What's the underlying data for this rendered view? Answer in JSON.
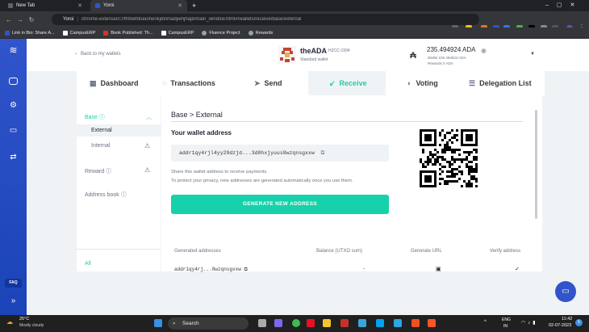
{
  "browser": {
    "tabs": [
      {
        "title": "New Tab"
      },
      {
        "title": "Yoroi"
      }
    ],
    "url_name": "Yoroi",
    "url": "chrome-extension://ffnbelfdoeiohenkjibnmadjiehjhajb/main_window.html#/wallets/receive/base/external",
    "bookmarks": [
      "Link in Bio: Share A...",
      "CampusERP",
      "Book Published: Th...",
      "CampusERP",
      "Fluence Project",
      "Rewards"
    ]
  },
  "header": {
    "back": "Back to my wallets",
    "wallet_name": "theADA",
    "wallet_code": "HZCC-1594",
    "wallet_type": "Standard wallet",
    "balance": "235.494924 ADA",
    "wallet_line": "Wallet 235.494924 ADA",
    "rewards_line": "Rewards 0 ADA"
  },
  "tabs": [
    {
      "label": "Dashboard",
      "icon": "dashboard-icon"
    },
    {
      "label": "Transactions",
      "icon": "transactions-icon"
    },
    {
      "label": "Send",
      "icon": "send-icon"
    },
    {
      "label": "Receive",
      "icon": "receive-icon"
    },
    {
      "label": "Voting",
      "icon": "voting-icon"
    },
    {
      "label": "Delegation List",
      "icon": "list-icon"
    }
  ],
  "leftnav": {
    "base": "Base",
    "external": "External",
    "internal": "Internal",
    "reward": "Reward",
    "address_book": "Address book",
    "all": "All"
  },
  "panel": {
    "title": "Base > External",
    "subtitle": "Your wallet address",
    "address": "addr1qy4rjl4yy29dzjd...3d8hxjyuus8wzqnsgxxw",
    "info1": "Share this wallet address to receive payments.",
    "info2": "To protect your privacy, new addresses are generated automatically once you use them.",
    "generate": "GENERATE NEW ADDRESS",
    "columns": [
      "Generated addresses",
      "Balance (UTXO sum)",
      "Generate URL",
      "Verify address"
    ],
    "row_address": "addr1qy4rj...8wzqnsgxxw",
    "row_balance": "-"
  },
  "sidebar": {
    "faq": "FAQ"
  },
  "taskbar": {
    "temp": "25°C",
    "weather": "Mostly cloudy",
    "search": "Search",
    "lang1": "ENG",
    "lang2": "IN",
    "time": "11:42",
    "date": "02-07-2023",
    "notif": "5"
  }
}
